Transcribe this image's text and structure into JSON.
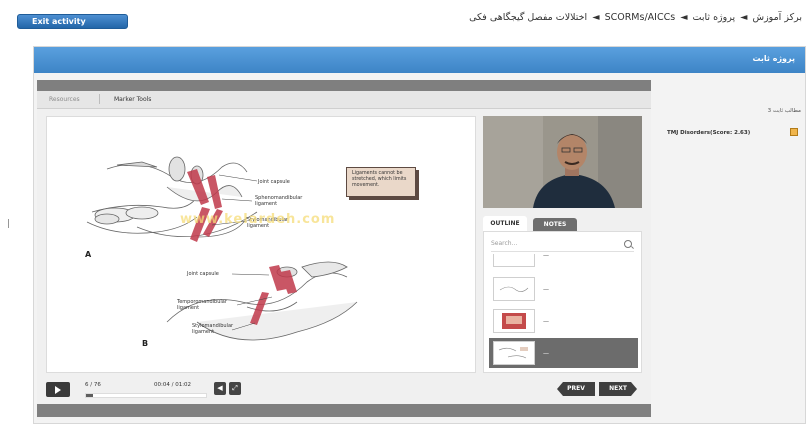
{
  "topbar": {
    "exit_label": "Exit activity",
    "breadcrumb": [
      "برکز آموزش",
      "پروژه ثابت",
      "SCORMs/AICCs",
      "اختلالات مفصل گیجگاهی فکی"
    ],
    "separator": "◄"
  },
  "panel": {
    "title": "پروژه ثابت"
  },
  "player": {
    "tabs": [
      "Resources",
      "Marker Tools"
    ],
    "slide": {
      "labels": {
        "joint_capsule_top": "Joint capsule",
        "sphenomandibular": "Sphenomandibular ligament",
        "stylomandibular_top": "Stylomandibular ligament",
        "joint_capsule_bottom": "Joint capsule",
        "temporomandibular": "Temporomandibular ligament",
        "stylomandibular_bottom": "Stylomandibular ligament"
      },
      "letters": {
        "a": "A",
        "b": "B"
      },
      "callout": "Ligaments cannot be stretched, which limits movement.",
      "watermark": "www.kelardeh.com"
    },
    "outline": {
      "tab_outline": "OUTLINE",
      "tab_notes": "NOTES",
      "search_placeholder": "Search...",
      "items": [
        "—",
        "—",
        "—",
        "—"
      ],
      "selected_index": 3
    },
    "controls": {
      "slide_count": "6 / 76",
      "time": "00:04 / 01:02",
      "progress": 0.06,
      "prev_label": "PREV",
      "next_label": "NEXT"
    }
  },
  "sidebar": {
    "subtitle": "مطالب ثابت 3",
    "item_label": "TMJ Disorders(Score: 2.63)"
  },
  "colors": {
    "header_blue": "#3d84c6",
    "exit_blue": "#2366a8",
    "dark_control": "#3f3f3f",
    "strip_gray": "#7f7f7f",
    "ligament_red": "#c0394b",
    "callout_fill": "#ead8c9"
  }
}
